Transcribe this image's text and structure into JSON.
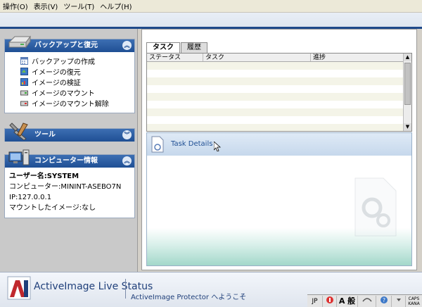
{
  "menubar": {
    "items": [
      "操作(O)",
      "表示(V)",
      "ツール(T)",
      "ヘルプ(H)"
    ]
  },
  "sidebar": {
    "backup_panel": {
      "title": "バックアップと復元",
      "items": [
        {
          "label": "バックアップの作成",
          "icon": "calendar-icon"
        },
        {
          "label": "イメージの復元",
          "icon": "restore-image-icon"
        },
        {
          "label": "イメージの検証",
          "icon": "verify-image-icon"
        },
        {
          "label": "イメージのマウント",
          "icon": "mount-image-icon"
        },
        {
          "label": "イメージのマウント解除",
          "icon": "unmount-image-icon"
        }
      ]
    },
    "tools_panel": {
      "title": "ツール"
    },
    "computer_panel": {
      "title": "コンピューター情報",
      "username": "ユーザー名:SYSTEM",
      "computer": "コンピューター:MININT-ASEBO7N",
      "ip": "IP:127.0.0.1",
      "mounted": "マウントしたイメージ:なし"
    }
  },
  "main": {
    "tabs": [
      {
        "label": "タスク"
      },
      {
        "label": "履歴"
      }
    ],
    "table": {
      "columns": [
        "ステータス",
        "タスク",
        "進捗"
      ]
    },
    "details": {
      "title": "Task Details"
    }
  },
  "footer": {
    "brand": "ActiveImage Live Status",
    "welcome": "ActiveImage Protector へようこそ"
  },
  "tray": {
    "lang": "JP",
    "ime_mode": "A",
    "ime_kana": "般",
    "caps": "CAPS",
    "kana": "KANA"
  },
  "colors": {
    "accent": "#1f4f94",
    "panel_head": "#2d5ea3",
    "logo_red": "#c0282d"
  }
}
